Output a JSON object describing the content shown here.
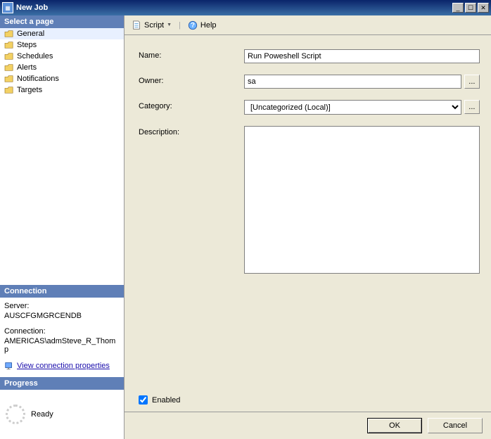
{
  "window": {
    "title": "New Job"
  },
  "toolbar": {
    "script": "Script",
    "help": "Help"
  },
  "sidebar": {
    "select_page_header": "Select a page",
    "pages": [
      {
        "label": "General",
        "selected": true
      },
      {
        "label": "Steps",
        "selected": false
      },
      {
        "label": "Schedules",
        "selected": false
      },
      {
        "label": "Alerts",
        "selected": false
      },
      {
        "label": "Notifications",
        "selected": false
      },
      {
        "label": "Targets",
        "selected": false
      }
    ],
    "connection_header": "Connection",
    "server_label": "Server:",
    "server_value": "AUSCFGMGRCENDB",
    "connection_label": "Connection:",
    "connection_value": "AMERICAS\\admSteve_R_Thomp",
    "view_conn_link": "View connection properties",
    "progress_header": "Progress",
    "progress_status": "Ready"
  },
  "form": {
    "name_label": "Name:",
    "name_value": "Run Poweshell Script",
    "owner_label": "Owner:",
    "owner_value": "sa",
    "category_label": "Category:",
    "category_value": "[Uncategorized (Local)]",
    "description_label": "Description:",
    "description_value": "",
    "enabled_label": "Enabled",
    "enabled_checked": true,
    "browse_label": "..."
  },
  "footer": {
    "ok": "OK",
    "cancel": "Cancel"
  }
}
